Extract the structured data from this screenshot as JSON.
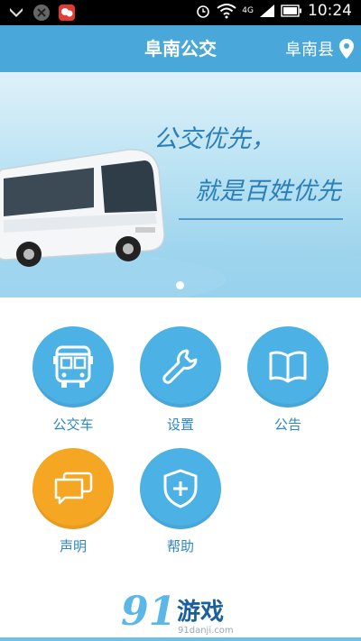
{
  "status_bar": {
    "icons": [
      "notification-icon",
      "app-icon",
      "message-app-icon",
      "alarm-icon",
      "wifi-icon",
      "signal-icon",
      "battery-icon"
    ],
    "network": "4G",
    "time": "10:24"
  },
  "header": {
    "title": "阜南公交",
    "city": "阜南县"
  },
  "banner": {
    "line1": "公交优先，",
    "line2": "就是百姓优先"
  },
  "menu": {
    "items": [
      {
        "label": "公交车",
        "icon": "bus-icon",
        "color": "#4cb1e5"
      },
      {
        "label": "设置",
        "icon": "wrench-icon",
        "color": "#4cb1e5"
      },
      {
        "label": "公告",
        "icon": "book-icon",
        "color": "#4cb1e5"
      },
      {
        "label": "声明",
        "icon": "chat-icon",
        "color": "#f5a623"
      },
      {
        "label": "帮助",
        "icon": "shield-plus-icon",
        "color": "#4cb1e5"
      }
    ]
  },
  "footer": {
    "number": "91",
    "brand": "游戏",
    "url": "91danji.com"
  },
  "colors": {
    "header": "#4aa7d9",
    "accent": "#4cb1e5",
    "orange": "#f5a623",
    "label": "#2e87c2"
  }
}
